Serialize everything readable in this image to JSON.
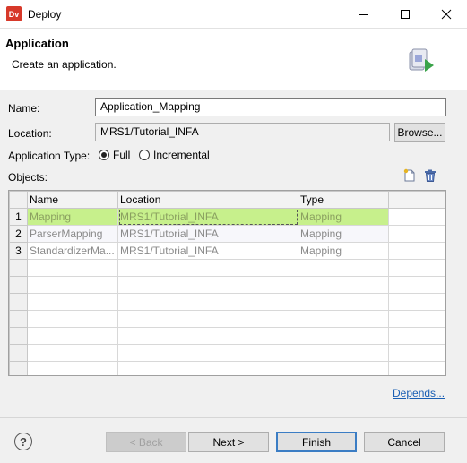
{
  "window": {
    "title": "Deploy",
    "app_icon_label": "Dv",
    "minimize_glyph": "—",
    "close_glyph": "✕"
  },
  "header": {
    "title": "Application",
    "description": "Create an application."
  },
  "form": {
    "name_label": "Name:",
    "name_value": "Application_Mapping",
    "location_label": "Location:",
    "location_value": "MRS1/Tutorial_INFA",
    "browse_label": "Browse...",
    "app_type_label": "Application Type:",
    "type_full": "Full",
    "type_incremental": "Incremental",
    "selected_type": "Full",
    "objects_label": "Objects:"
  },
  "table": {
    "columns": [
      "Name",
      "Location",
      "Type"
    ],
    "rows": [
      {
        "num": "1",
        "name": "Mapping",
        "location": "MRS1/Tutorial_INFA",
        "type": "Mapping"
      },
      {
        "num": "2",
        "name": "ParserMapping",
        "location": "MRS1/Tutorial_INFA",
        "type": "Mapping"
      },
      {
        "num": "3",
        "name": "StandardizerMa...",
        "location": "MRS1/Tutorial_INFA",
        "type": "Mapping"
      }
    ]
  },
  "links": {
    "depends": "Depends..."
  },
  "footer": {
    "help_glyph": "?",
    "back_label": "< Back",
    "next_label": "Next >",
    "finish_label": "Finish",
    "cancel_label": "Cancel"
  },
  "colors": {
    "selected_row": "#c7f08c",
    "link": "#1a5fb4",
    "app_icon": "#d7392a"
  }
}
